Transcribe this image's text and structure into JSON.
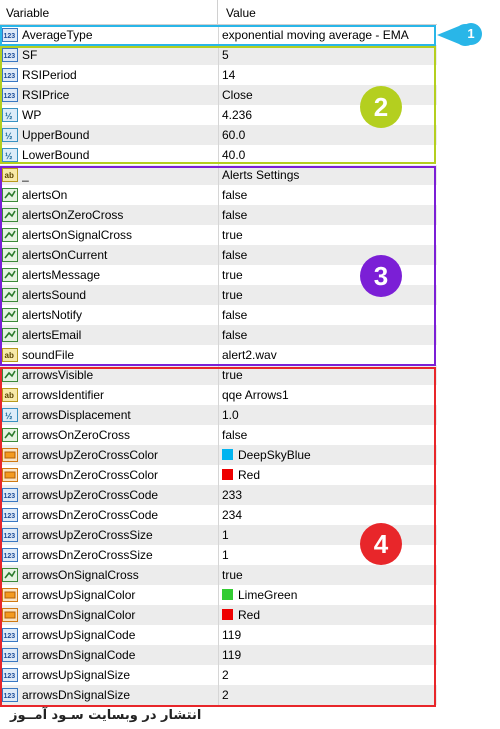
{
  "header": {
    "col_variable": "Variable",
    "col_value": "Value"
  },
  "rows": [
    {
      "name": "AverageType",
      "value": "exponential moving average - EMA",
      "icon": "int-icon"
    },
    {
      "name": "SF",
      "value": "5",
      "icon": "int-icon"
    },
    {
      "name": "RSIPeriod",
      "value": "14",
      "icon": "int-icon"
    },
    {
      "name": "RSIPrice",
      "value": "Close",
      "icon": "int-icon"
    },
    {
      "name": "WP",
      "value": "4.236",
      "icon": "double-icon"
    },
    {
      "name": "UpperBound",
      "value": "60.0",
      "icon": "double-icon"
    },
    {
      "name": "LowerBound",
      "value": "40.0",
      "icon": "double-icon"
    },
    {
      "name": "_",
      "value": "Alerts Settings",
      "icon": "string-icon"
    },
    {
      "name": "alertsOn",
      "value": "false",
      "icon": "bool-icon"
    },
    {
      "name": "alertsOnZeroCross",
      "value": "false",
      "icon": "bool-icon"
    },
    {
      "name": "alertsOnSignalCross",
      "value": "true",
      "icon": "bool-icon"
    },
    {
      "name": "alertsOnCurrent",
      "value": "false",
      "icon": "bool-icon"
    },
    {
      "name": "alertsMessage",
      "value": "true",
      "icon": "bool-icon"
    },
    {
      "name": "alertsSound",
      "value": "true",
      "icon": "bool-icon"
    },
    {
      "name": "alertsNotify",
      "value": "false",
      "icon": "bool-icon"
    },
    {
      "name": "alertsEmail",
      "value": "false",
      "icon": "bool-icon"
    },
    {
      "name": "soundFile",
      "value": "alert2.wav",
      "icon": "string-icon"
    },
    {
      "name": "arrowsVisible",
      "value": "true",
      "icon": "bool-icon"
    },
    {
      "name": "arrowsIdentifier",
      "value": "qqe Arrows1",
      "icon": "string-icon"
    },
    {
      "name": "arrowsDisplacement",
      "value": "1.0",
      "icon": "double-icon"
    },
    {
      "name": "arrowsOnZeroCross",
      "value": "false",
      "icon": "bool-icon"
    },
    {
      "name": "arrowsUpZeroCrossColor",
      "value": "DeepSkyBlue",
      "icon": "color-icon",
      "swatch": "#00b4f0"
    },
    {
      "name": "arrowsDnZeroCrossColor",
      "value": "Red",
      "icon": "color-icon",
      "swatch": "#ee0000"
    },
    {
      "name": "arrowsUpZeroCrossCode",
      "value": "233",
      "icon": "int-icon"
    },
    {
      "name": "arrowsDnZeroCrossCode",
      "value": "234",
      "icon": "int-icon"
    },
    {
      "name": "arrowsUpZeroCrossSize",
      "value": "1",
      "icon": "int-icon"
    },
    {
      "name": "arrowsDnZeroCrossSize",
      "value": "1",
      "icon": "int-icon"
    },
    {
      "name": "arrowsOnSignalCross",
      "value": "true",
      "icon": "bool-icon"
    },
    {
      "name": "arrowsUpSignalColor",
      "value": "LimeGreen",
      "icon": "color-icon",
      "swatch": "#33cc33"
    },
    {
      "name": "arrowsDnSignalColor",
      "value": "Red",
      "icon": "color-icon",
      "swatch": "#ee0000"
    },
    {
      "name": "arrowsUpSignalCode",
      "value": "119",
      "icon": "int-icon"
    },
    {
      "name": "arrowsDnSignalCode",
      "value": "119",
      "icon": "int-icon"
    },
    {
      "name": "arrowsUpSignalSize",
      "value": "2",
      "icon": "int-icon"
    },
    {
      "name": "arrowsDnSignalSize",
      "value": "2",
      "icon": "int-icon"
    }
  ],
  "groups": [
    {
      "label": "1",
      "color": "#29b6e8"
    },
    {
      "label": "2",
      "color": "#b4cf1f"
    },
    {
      "label": "3",
      "color": "#7b1fd6"
    },
    {
      "label": "4",
      "color": "#e8262a"
    }
  ],
  "icon_labels": {
    "int": "123",
    "double": "½",
    "string": "ab"
  },
  "footer": "انتشار در وبسایت سـود آمــوز"
}
